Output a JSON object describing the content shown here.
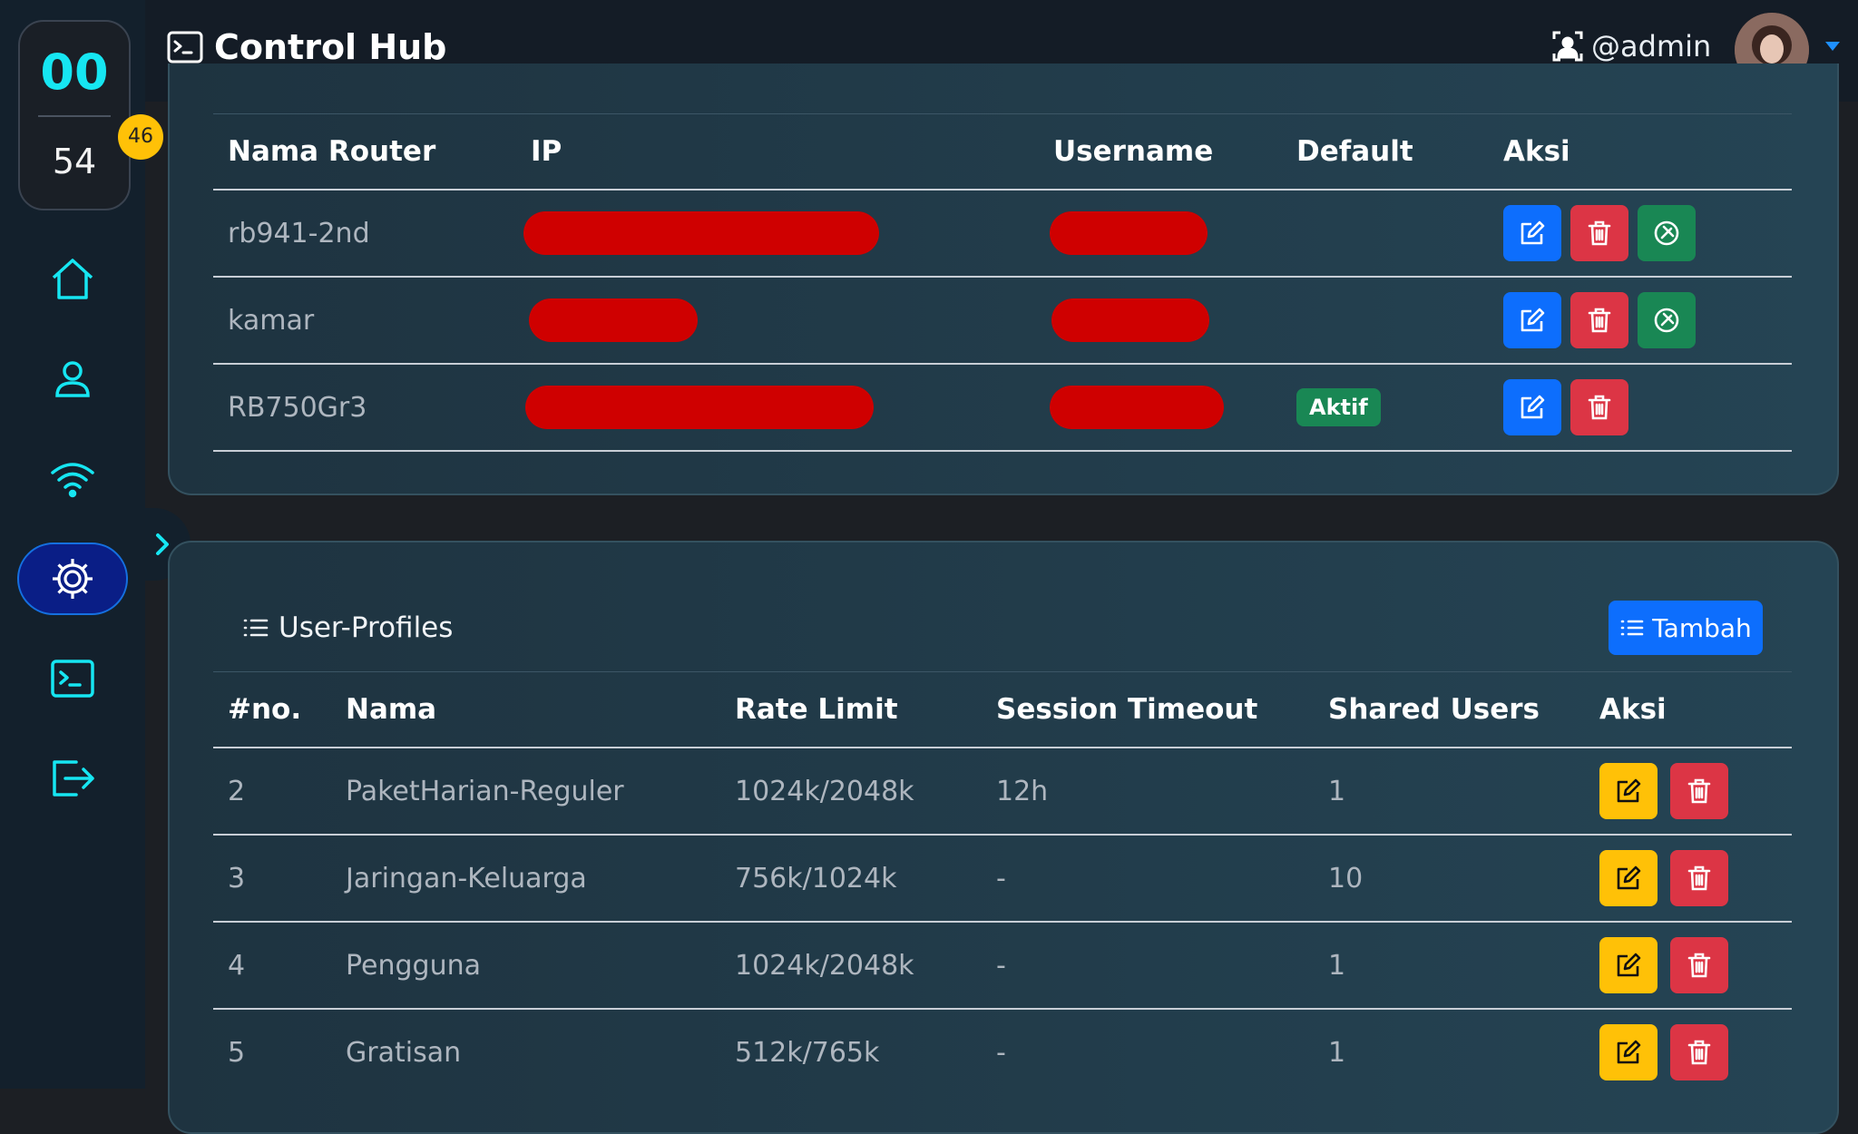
{
  "clock": {
    "hours": "00",
    "minutes": "54",
    "seconds": "46"
  },
  "sidebar": {
    "items": [
      "home-icon",
      "user-icon",
      "wifi-icon",
      "settings-icon",
      "terminal-icon",
      "logout-icon"
    ],
    "active": "settings-icon"
  },
  "header": {
    "title": "Control Hub",
    "user": "@admin"
  },
  "routers": {
    "columns": [
      "Nama Router",
      "IP",
      "Username",
      "Default",
      "Aksi"
    ],
    "rows": [
      {
        "name": "rb941-2nd",
        "ip": "",
        "username": "",
        "default": "",
        "actions": [
          "edit",
          "delete",
          "connect"
        ]
      },
      {
        "name": "kamar",
        "ip": "",
        "username": "",
        "default": "",
        "actions": [
          "edit",
          "delete",
          "connect"
        ]
      },
      {
        "name": "RB750Gr3",
        "ip": "",
        "username": "",
        "default": "Aktif",
        "actions": [
          "edit",
          "delete"
        ]
      }
    ]
  },
  "profiles": {
    "title": "User-Profiles",
    "add_label": "Tambah",
    "columns": [
      "#no.",
      "Nama",
      "Rate Limit",
      "Session Timeout",
      "Shared Users",
      "Aksi"
    ],
    "rows": [
      {
        "no": "2",
        "name": "PaketHarian-Reguler",
        "rate": "1024k/2048k",
        "timeout": "12h",
        "shared": "1"
      },
      {
        "no": "3",
        "name": "Jaringan-Keluarga",
        "rate": "756k/1024k",
        "timeout": "-",
        "shared": "10"
      },
      {
        "no": "4",
        "name": "Pengguna",
        "rate": "1024k/2048k",
        "timeout": "-",
        "shared": "1"
      },
      {
        "no": "5",
        "name": "Gratisan",
        "rate": "512k/765k",
        "timeout": "-",
        "shared": "1"
      }
    ]
  },
  "colors": {
    "accent": "#16e6f2",
    "primary": "#0d6efd",
    "danger": "#dc3545",
    "success": "#198754",
    "warning": "#ffc107",
    "redaction": "#cf0000"
  }
}
